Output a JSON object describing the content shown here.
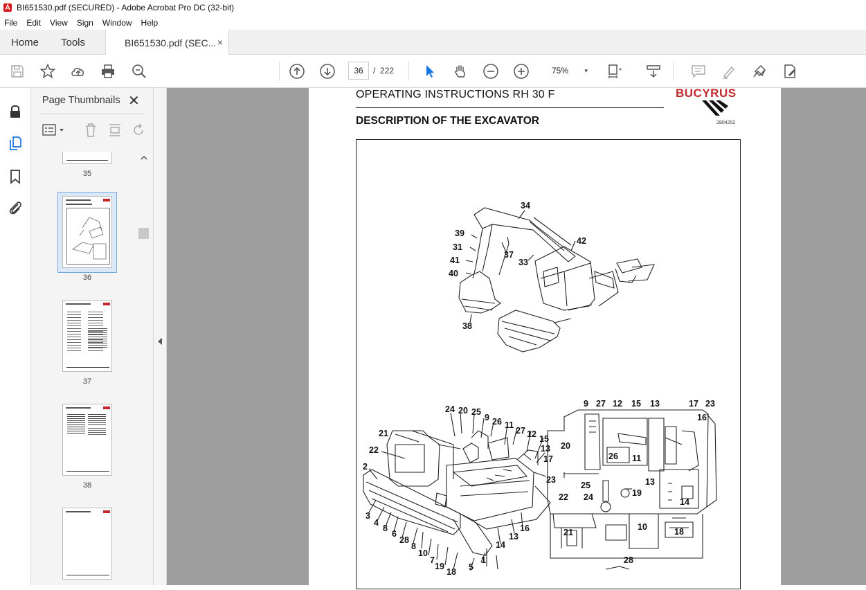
{
  "window": {
    "title": "BI651530.pdf (SECURED) - Adobe Acrobat Pro DC (32-bit)"
  },
  "menu": [
    "File",
    "Edit",
    "View",
    "Sign",
    "Window",
    "Help"
  ],
  "tabs": {
    "home": "Home",
    "tools": "Tools",
    "document": "BI651530.pdf (SEC...",
    "close": "×"
  },
  "toolbar": {
    "current_page": "36",
    "page_separator": "/",
    "total_pages": "222",
    "zoom": "75%",
    "zoom_caret": "▾"
  },
  "thumbnails_panel": {
    "title": "Page Thumbnails",
    "close": "✕",
    "pages": [
      {
        "label": "35"
      },
      {
        "label": "36",
        "selected": true
      },
      {
        "label": "37"
      },
      {
        "label": "38"
      }
    ]
  },
  "page": {
    "header": "OPERATING INSTRUCTIONS RH 30 F",
    "section_title": "DESCRIPTION OF THE EXCAVATOR",
    "brand": "BUCYRUS",
    "doc_number": "2804202",
    "brand_color": "#c0282d",
    "callouts_top": [
      "34",
      "39",
      "42",
      "31",
      "37",
      "41",
      "33",
      "40",
      "38"
    ],
    "callouts_left": [
      "24",
      "20",
      "25",
      "9",
      "26",
      "11",
      "27",
      "12",
      "15",
      "21",
      "13",
      "22",
      "17",
      "2",
      "23",
      "3",
      "4",
      "8",
      "6",
      "28",
      "8",
      "10",
      "7",
      "19",
      "18",
      "5",
      "1",
      "14",
      "13",
      "16"
    ],
    "callouts_right": [
      "9",
      "27",
      "12",
      "15",
      "13",
      "17",
      "23",
      "16",
      "20",
      "26",
      "11",
      "13",
      "25",
      "19",
      "24",
      "14",
      "22",
      "10",
      "21",
      "18",
      "28"
    ]
  }
}
